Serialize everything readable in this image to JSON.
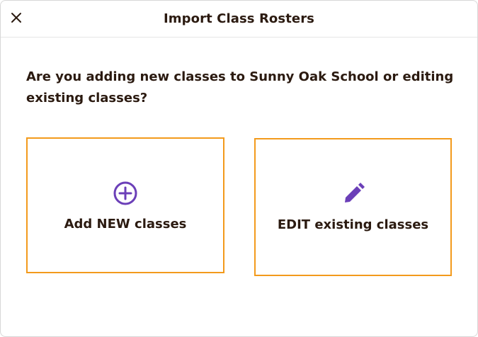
{
  "dialog": {
    "title": "Import Class Rosters",
    "close_icon": "close-icon"
  },
  "question": "Are you adding new classes to Sunny Oak School or editing existing classes?",
  "options": [
    {
      "label": "Add NEW classes",
      "icon": "plus-circle-icon"
    },
    {
      "label": "EDIT existing classes",
      "icon": "pencil-icon"
    }
  ],
  "colors": {
    "text": "#2b1a10",
    "accent_border": "#f39a1c",
    "icon": "#6b3fb8"
  }
}
